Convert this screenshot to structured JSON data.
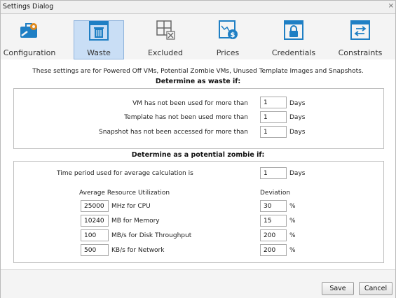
{
  "window": {
    "title": "Settings Dialog",
    "close_glyph": "×"
  },
  "toolbar": {
    "items": [
      {
        "label": "Configuration",
        "icon": "briefcase-gear-icon"
      },
      {
        "label": "Waste",
        "icon": "trash-can-icon",
        "selected": true
      },
      {
        "label": "Excluded",
        "icon": "excluded-grid-icon"
      },
      {
        "label": "Prices",
        "icon": "chart-dollar-icon"
      },
      {
        "label": "Credentials",
        "icon": "lock-window-icon"
      },
      {
        "label": "Constraints",
        "icon": "arrows-window-icon"
      }
    ]
  },
  "intro": "These settings are for Powered Off VMs, Potential Zombie VMs, Unused Template Images and Snapshots.",
  "waste": {
    "heading": "Determine as waste if:",
    "rows": [
      {
        "label": "VM has not been used for more than",
        "value": "1",
        "unit": "Days"
      },
      {
        "label": "Template has not been used more than",
        "value": "1",
        "unit": "Days"
      },
      {
        "label": "Snapshot has not been accessed for more than",
        "value": "1",
        "unit": "Days"
      }
    ]
  },
  "zombie": {
    "heading": "Determine as a potential zombie if:",
    "period_label": "Time period used for average calculation is",
    "period_value": "1",
    "period_unit": "Days",
    "util_header": "Average Resource Utilization",
    "dev_header": "Deviation",
    "rows": [
      {
        "value": "25000",
        "label": "MHz for CPU",
        "deviation": "30",
        "dev_unit": "%"
      },
      {
        "value": "10240",
        "label": "MB for Memory",
        "deviation": "15",
        "dev_unit": "%"
      },
      {
        "value": "100",
        "label": "MB/s for Disk Throughput",
        "deviation": "200",
        "dev_unit": "%"
      },
      {
        "value": "500",
        "label": "KB/s for Network",
        "deviation": "200",
        "dev_unit": "%"
      }
    ]
  },
  "buttons": {
    "save": "Save",
    "cancel": "Cancel"
  },
  "colors": {
    "icon_blue": "#1f7fc4",
    "icon_orange": "#e08a1e",
    "selected_bg": "#c9def5"
  }
}
